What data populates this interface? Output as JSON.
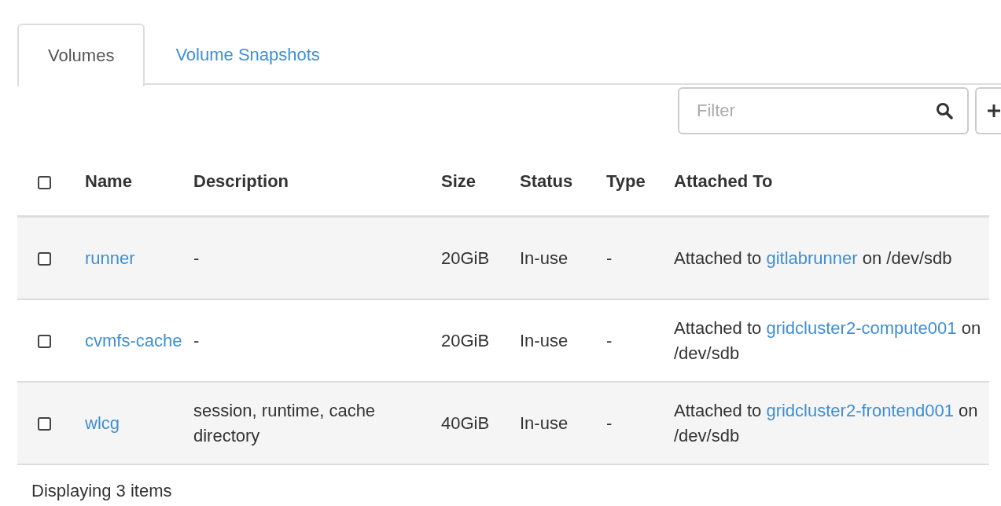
{
  "tabs": [
    {
      "label": "Volumes",
      "selected": true
    },
    {
      "label": "Volume Snapshots",
      "selected": false
    }
  ],
  "filter": {
    "placeholder": "Filter"
  },
  "table": {
    "select_all_checked": false,
    "columns": [
      "Name",
      "Description",
      "Size",
      "Status",
      "Type",
      "Attached To"
    ],
    "rows": [
      {
        "checked": false,
        "name": "runner",
        "description": "-",
        "size": "20GiB",
        "status": "In-use",
        "type": "-",
        "attached_prefix": "Attached to ",
        "attached_link": "gitlabrunner",
        "attached_suffix": " on /dev/sdb"
      },
      {
        "checked": false,
        "name": "cvmfs-cache",
        "description": "-",
        "size": "20GiB",
        "status": "In-use",
        "type": "-",
        "attached_prefix": "Attached to ",
        "attached_link": "gridcluster2-compute001",
        "attached_suffix": " on /dev/sdb"
      },
      {
        "checked": false,
        "name": "wlcg",
        "description": "session, runtime, cache directory",
        "size": "40GiB",
        "status": "In-use",
        "type": "-",
        "attached_prefix": "Attached to ",
        "attached_link": "gridcluster2-frontend001",
        "attached_suffix": " on /dev/sdb"
      }
    ]
  },
  "footer": "Displaying 3 items"
}
